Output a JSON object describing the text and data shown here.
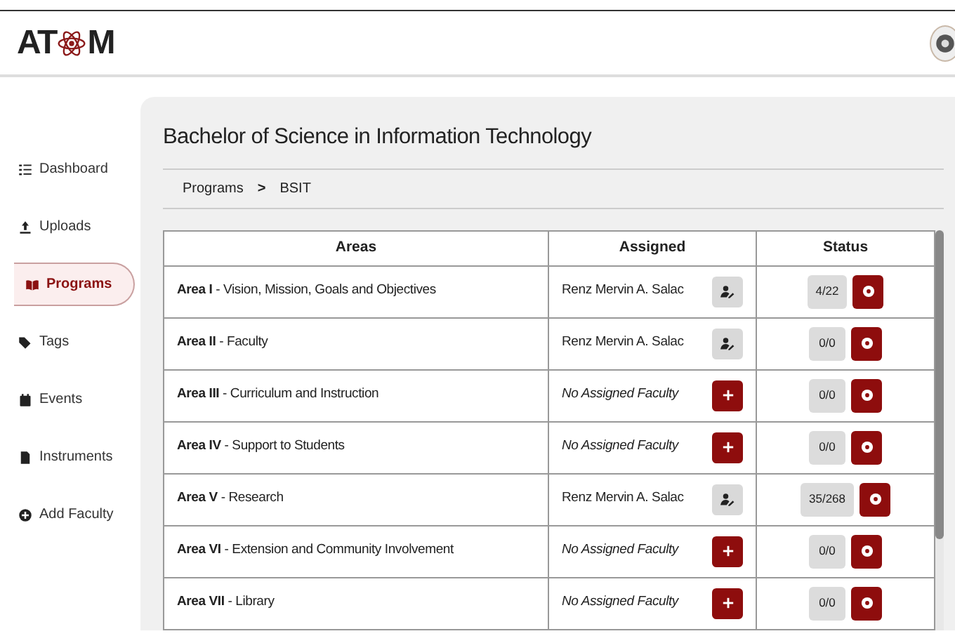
{
  "logo": {
    "before": "AT",
    "after": "M"
  },
  "sidebar": {
    "items": [
      {
        "label": "Dashboard",
        "selected": false
      },
      {
        "label": "Uploads",
        "selected": false
      },
      {
        "label": "Programs",
        "selected": true
      },
      {
        "label": "Tags",
        "selected": false
      },
      {
        "label": "Events",
        "selected": false
      },
      {
        "label": "Instruments",
        "selected": false
      },
      {
        "label": "Add Faculty",
        "selected": false
      }
    ]
  },
  "page_title": "Bachelor of Science in Information Technology",
  "breadcrumb": {
    "items": [
      "Programs",
      "BSIT"
    ],
    "separator": ">"
  },
  "table": {
    "columns": [
      "Areas",
      "Assigned",
      "Status"
    ],
    "rows": [
      {
        "area": "**Area I** - Vision, Mission, Goals and Objectives",
        "assigned": {
          "kind": "assigned",
          "text": "Renz Mervin A. Salac"
        },
        "status": "4/22"
      },
      {
        "area": "**Area II** - Faculty",
        "assigned": {
          "kind": "assigned",
          "text": "Renz Mervin A. Salac"
        },
        "status": "0/0"
      },
      {
        "area": "**Area III** - Curriculum and Instruction",
        "assigned": {
          "kind": "unassigned",
          "text": "No Assigned Faculty"
        },
        "status": "0/0"
      },
      {
        "area": "**Area IV** - Support to Students",
        "assigned": {
          "kind": "unassigned",
          "text": "No Assigned Faculty"
        },
        "status": "0/0"
      },
      {
        "area": "**Area V** - Research",
        "assigned": {
          "kind": "assigned",
          "text": "Renz Mervin A. Salac"
        },
        "status": "35/268"
      },
      {
        "area": "**Area VI** - Extension and Community Involvement",
        "assigned": {
          "kind": "unassigned",
          "text": "No Assigned Faculty"
        },
        "status": "0/0"
      },
      {
        "area": "**Area VII** - Library",
        "assigned": {
          "kind": "unassigned",
          "text": "No Assigned Faculty"
        },
        "status": "0/0"
      }
    ]
  }
}
